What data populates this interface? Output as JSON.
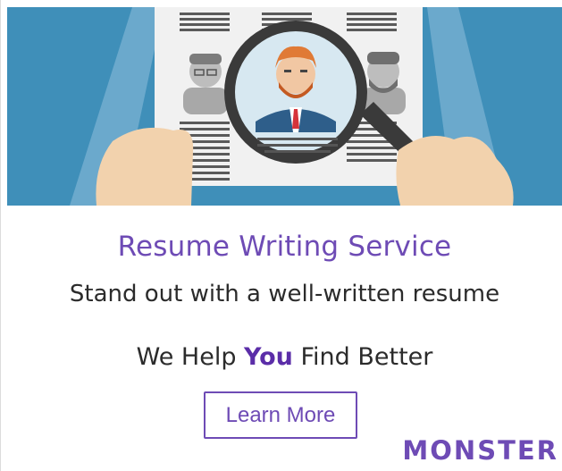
{
  "ad": {
    "headline": "Resume Writing Service",
    "subhead": "Stand out with a well-written resume",
    "tagline": {
      "before": "We Help ",
      "emphasis": "You",
      "after": " Find Better"
    },
    "cta_label": "Learn More",
    "brand": "MONSTER"
  },
  "colors": {
    "accent": "#6e4bb5",
    "brand_dark": "#5b2da8",
    "hero_background": "#3f8fb9",
    "text": "#2b2b2b"
  },
  "icons": [
    "resume-document",
    "magnifier-icon",
    "candidate-avatar"
  ]
}
